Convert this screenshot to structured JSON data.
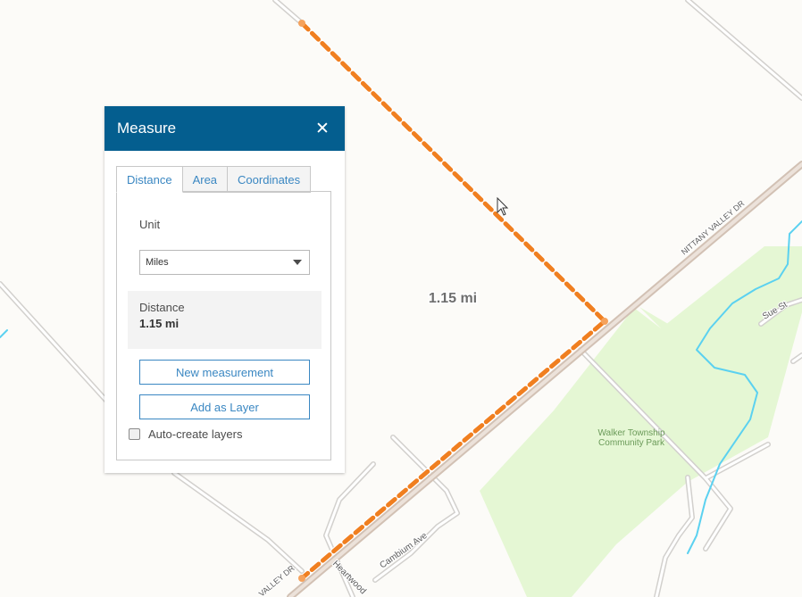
{
  "map": {
    "measurement_label": "1.15 mi",
    "road_labels": {
      "nittany_valley_dr_upper": "NITTANY VALLEY DR",
      "nittany_valley_dr_lower": "VALLEY DR",
      "sue_st": "Sue St",
      "cambium_ave": "Cambium Ave",
      "heartwood": "Heartwood"
    },
    "park_label_line1": "Walker Township",
    "park_label_line2": "Community Park",
    "colors": {
      "background": "#fcfbf8",
      "road": "#d6d4d1",
      "highway": "#d8c8bc",
      "park": "#e5f7d4",
      "water": "#5bd1f0",
      "measure_line": "#f07f20"
    }
  },
  "panel": {
    "title": "Measure",
    "close_icon": "close-icon",
    "tabs": [
      {
        "label": "Distance",
        "active": true
      },
      {
        "label": "Area",
        "active": false
      },
      {
        "label": "Coordinates",
        "active": false
      }
    ],
    "unit_label": "Unit",
    "unit_selected": "Miles",
    "result_label": "Distance",
    "result_value": "1.15 mi",
    "new_measurement_label": "New measurement",
    "add_layer_label": "Add as Layer",
    "auto_create_label": "Auto-create layers",
    "colors": {
      "header": "#045e8f",
      "accent": "#3a87c2"
    }
  }
}
